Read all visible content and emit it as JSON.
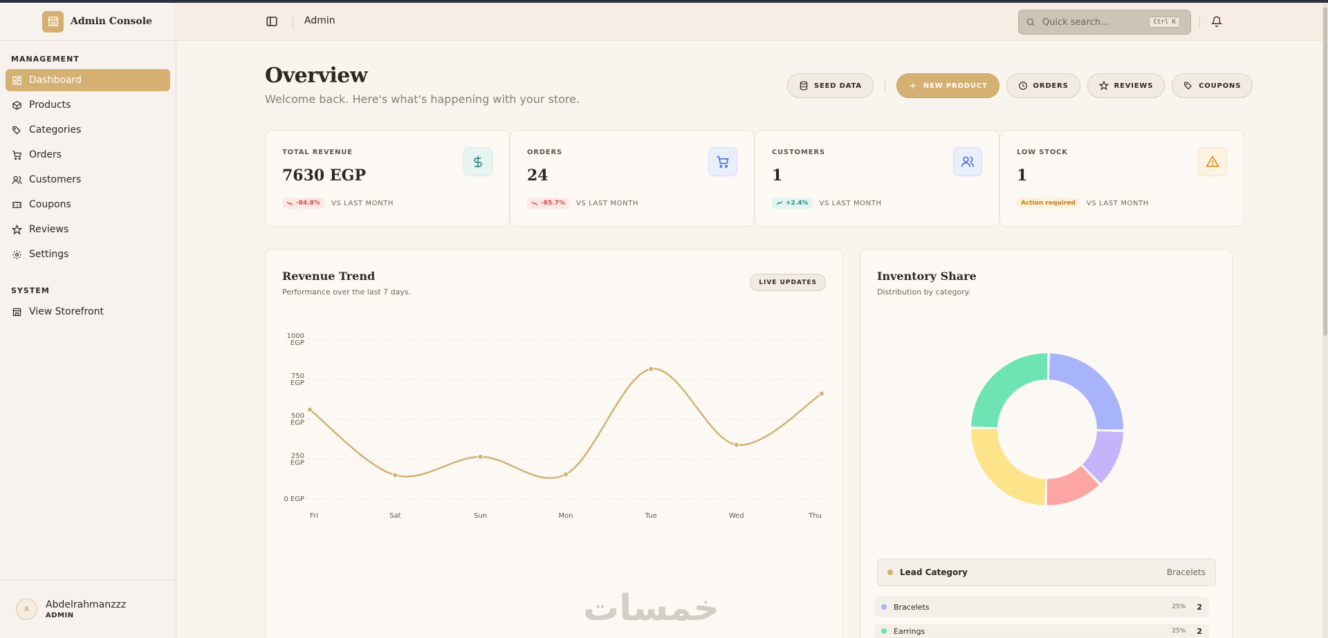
{
  "brand": {
    "name": "Admin Console"
  },
  "sidebar": {
    "management_heading": "MANAGEMENT",
    "items": [
      {
        "label": "Dashboard",
        "icon": "dashboard-icon",
        "active": true
      },
      {
        "label": "Products",
        "icon": "box-icon"
      },
      {
        "label": "Categories",
        "icon": "tags-icon"
      },
      {
        "label": "Orders",
        "icon": "cart-icon"
      },
      {
        "label": "Customers",
        "icon": "users-icon"
      },
      {
        "label": "Coupons",
        "icon": "ticket-icon"
      },
      {
        "label": "Reviews",
        "icon": "star-icon"
      },
      {
        "label": "Settings",
        "icon": "gear-icon"
      }
    ],
    "system_heading": "SYSTEM",
    "system_items": [
      {
        "label": "View Storefront",
        "icon": "store-icon"
      }
    ],
    "user": {
      "initial": "A",
      "name": "Abdelrahmanzzz",
      "role": "ADMIN"
    }
  },
  "header": {
    "title": "Admin",
    "search_placeholder": "Quick search...",
    "search_shortcut": "Ctrl K"
  },
  "page": {
    "title": "Overview",
    "subtitle": "Welcome back. Here's what's happening with your store."
  },
  "actions": {
    "seed": "SEED DATA",
    "new_product": "NEW PRODUCT",
    "orders": "ORDERS",
    "reviews": "REVIEWS",
    "coupons": "COUPONS"
  },
  "stats": [
    {
      "label": "TOTAL REVENUE",
      "value": "7630 EGP",
      "change": "-84.8%",
      "trend": "down",
      "vs": "VS LAST MONTH",
      "icon": "dollar-icon",
      "color": "#2b8c84",
      "bg": "#e7f5f2"
    },
    {
      "label": "ORDERS",
      "value": "24",
      "change": "-85.7%",
      "trend": "down",
      "vs": "VS LAST MONTH",
      "icon": "cart-icon",
      "color": "#4a6fd4",
      "bg": "#e9eefb"
    },
    {
      "label": "CUSTOMERS",
      "value": "1",
      "change": "+2.4%",
      "trend": "up",
      "vs": "VS LAST MONTH",
      "icon": "users-icon",
      "color": "#4a6fd4",
      "bg": "#e9eefb"
    },
    {
      "label": "LOW STOCK",
      "value": "1",
      "change": "Action required",
      "trend": "warn",
      "vs": "VS LAST MONTH",
      "icon": "warning-icon",
      "color": "#d88a1c",
      "bg": "#fdf3e3"
    }
  ],
  "revenue_panel": {
    "title": "Revenue Trend",
    "subtitle": "Performance over the last 7 days.",
    "badge": "LIVE UPDATES"
  },
  "inventory_panel": {
    "title": "Inventory Share",
    "subtitle": "Distribution by category.",
    "lead_label": "Lead Category",
    "lead_value": "Bracelets",
    "legend": [
      {
        "name": "Bracelets",
        "pct": "25%",
        "count": "2",
        "color": "#a8b4fa"
      },
      {
        "name": "Earrings",
        "pct": "25%",
        "count": "2",
        "color": "#6ee3b4"
      }
    ]
  },
  "watermark": "خمسات",
  "chart_data": [
    {
      "type": "line",
      "title": "Revenue Trend",
      "categories": [
        "Fri",
        "Sat",
        "Sun",
        "Mon",
        "Tue",
        "Wed",
        "Thu"
      ],
      "series": [
        {
          "values": [
            560,
            150,
            265,
            155,
            815,
            340,
            660
          ]
        }
      ],
      "yticks": [
        "0 EGP",
        "250 EGP",
        "500 EGP",
        "750 EGP",
        "1000 EGP"
      ],
      "ylim": [
        0,
        1000
      ],
      "grid": true,
      "color": "#d4b072"
    },
    {
      "type": "pie",
      "title": "Inventory Share",
      "donut": true,
      "slices": [
        {
          "value": 25,
          "color": "#a8b4fa"
        },
        {
          "value": 12.5,
          "color": "#c4b5fb"
        },
        {
          "value": 12.5,
          "color": "#fca5a5"
        },
        {
          "value": 25,
          "color": "#fde38a"
        },
        {
          "value": 25,
          "color": "#6ee3b4"
        }
      ]
    }
  ]
}
